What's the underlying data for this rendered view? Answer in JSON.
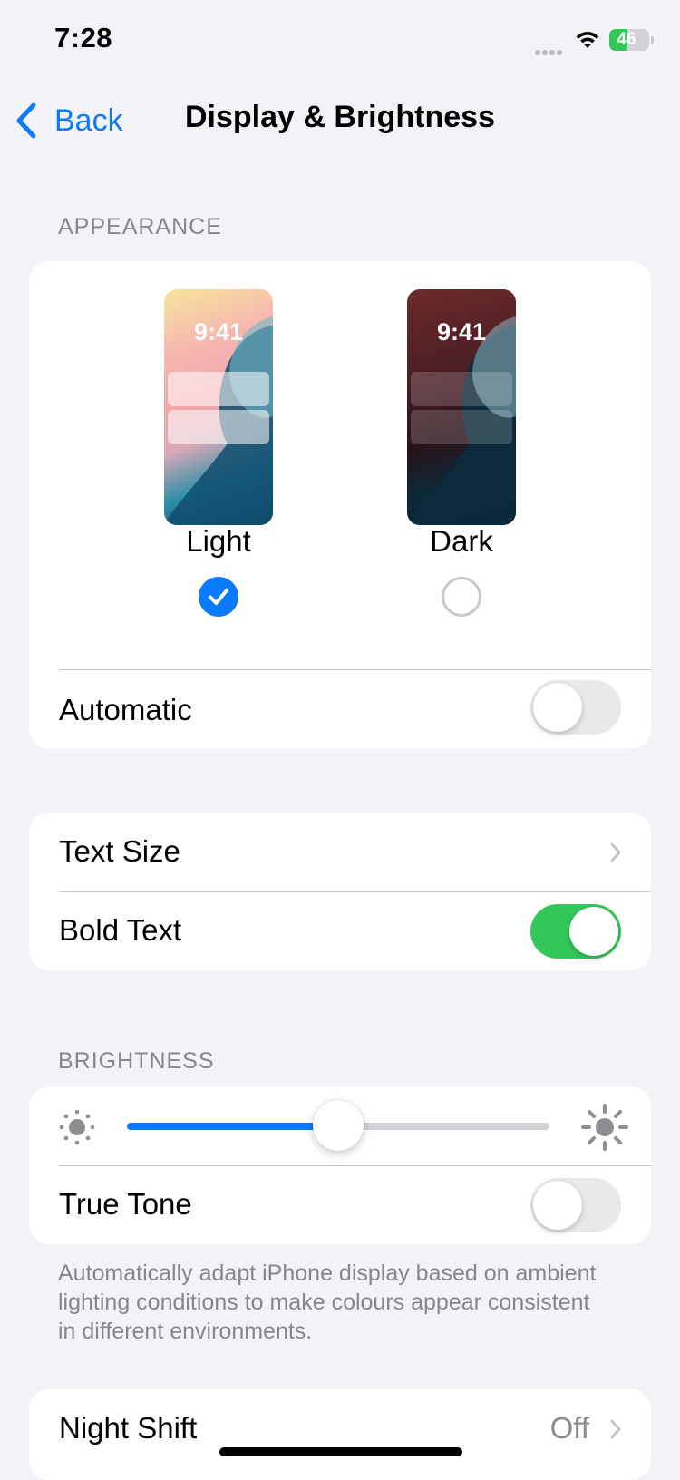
{
  "status_bar": {
    "time": "7:28",
    "battery_level": "46",
    "battery_fraction": 0.46
  },
  "nav": {
    "back_label": "Back",
    "title": "Display & Brightness"
  },
  "appearance": {
    "header": "APPEARANCE",
    "light": {
      "preview_time": "9:41",
      "label": "Light",
      "selected": true
    },
    "dark": {
      "preview_time": "9:41",
      "label": "Dark",
      "selected": false
    },
    "automatic": {
      "label": "Automatic",
      "on": false
    }
  },
  "text_settings": {
    "text_size_label": "Text Size",
    "bold_text": {
      "label": "Bold Text",
      "on": true
    }
  },
  "brightness": {
    "header": "BRIGHTNESS",
    "level": 0.5,
    "true_tone": {
      "label": "True Tone",
      "on": false
    },
    "footer": "Automatically adapt iPhone display based on ambient lighting conditions to make colours appear consistent in different environments."
  },
  "night_shift": {
    "label": "Night Shift",
    "value": "Off"
  },
  "colors": {
    "accent": "#0A7AFF",
    "toggle_on": "#34C759",
    "background": "#F2F2F7"
  },
  "icons": [
    "chevron-left-icon",
    "wifi-icon",
    "battery-icon",
    "sun-small-icon",
    "sun-large-icon",
    "chevron-right-icon",
    "checkmark-icon"
  ]
}
